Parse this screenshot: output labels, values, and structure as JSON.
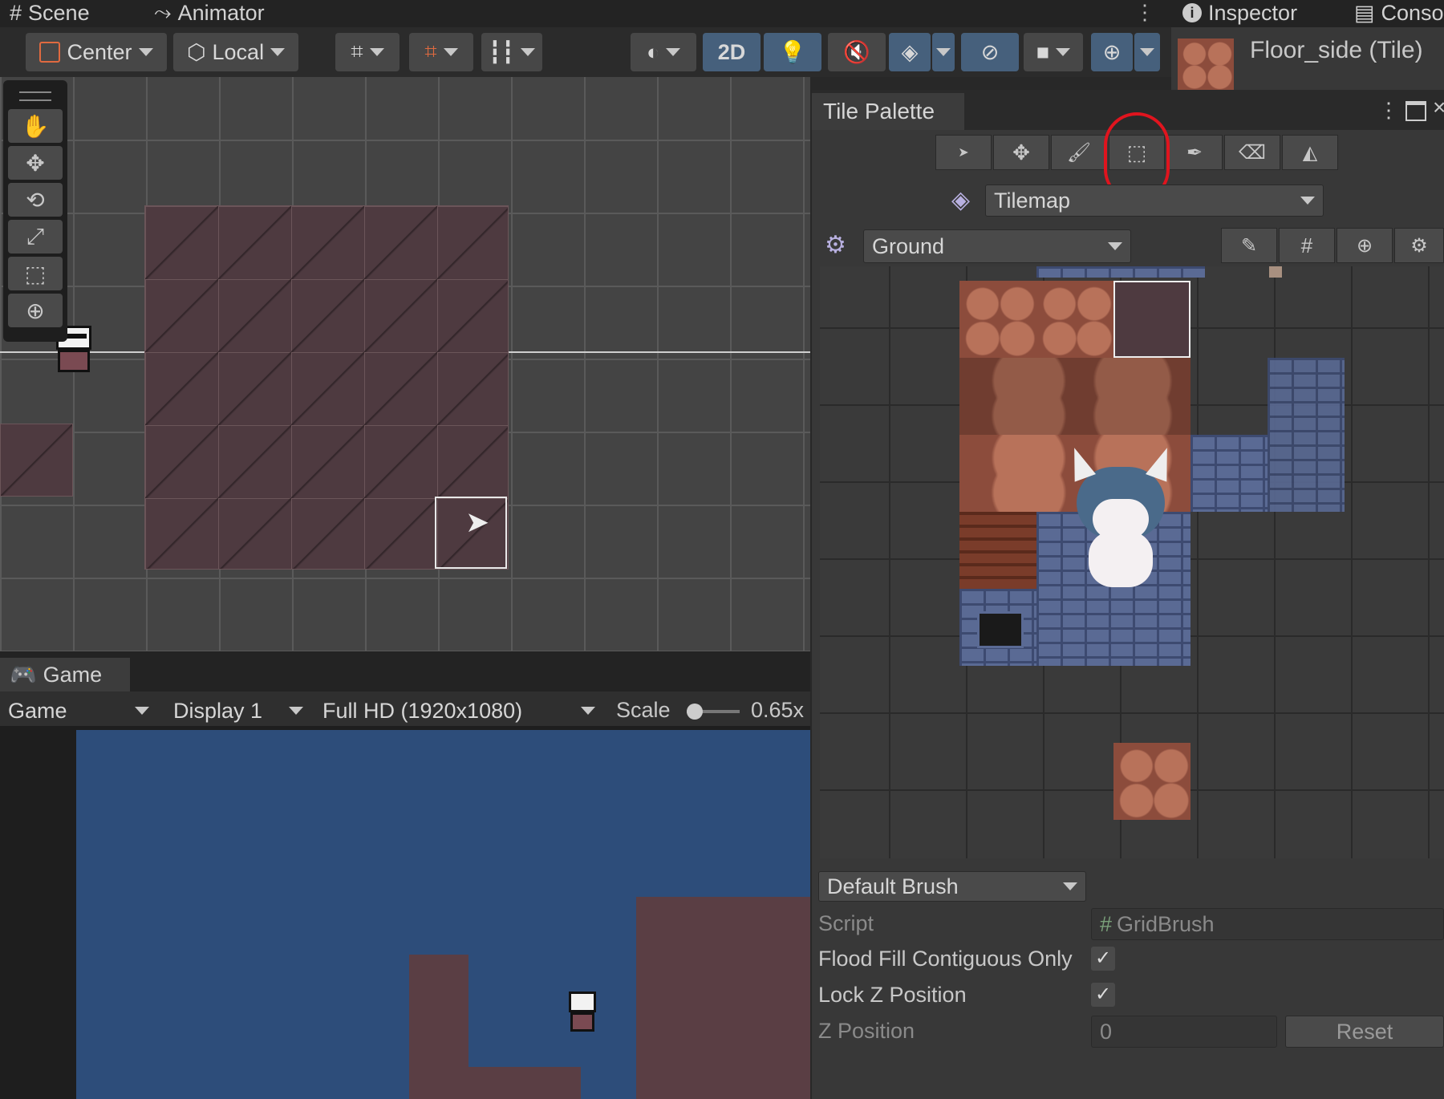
{
  "tabs": {
    "scene": "Scene",
    "animator": "Animator",
    "inspector": "Inspector",
    "console": "Conso"
  },
  "scene_toolbar": {
    "pivot": "Center",
    "space": "Local",
    "mode_2d": "2D"
  },
  "inspector": {
    "selected": "Floor_side (Tile)"
  },
  "tile_palette": {
    "title": "Tile Palette",
    "active_target": "Tilemap",
    "palette": "Ground",
    "brush": "Default Brush",
    "script_label": "Script",
    "script_value": "GridBrush",
    "flood_fill_label": "Flood Fill Contiguous Only",
    "flood_fill_checked": true,
    "lock_z_label": "Lock Z Position",
    "lock_z_checked": true,
    "z_position_label": "Z Position",
    "z_position_value": "0",
    "reset_label": "Reset"
  },
  "game": {
    "tab": "Game",
    "view": "Game",
    "display": "Display 1",
    "resolution": "Full HD (1920x1080)",
    "scale_label": "Scale",
    "scale_value": "0.65x"
  },
  "colors": {
    "annotation": "#e0141e",
    "active_toggle": "#46607c",
    "game_bg": "#2d4d7a"
  }
}
